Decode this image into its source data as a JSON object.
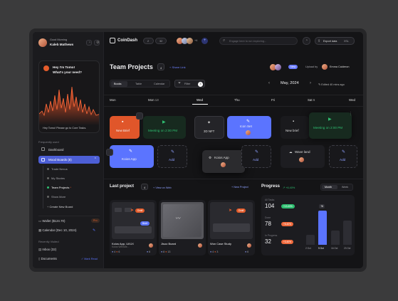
{
  "sidebar": {
    "greeting": "Good Morning",
    "user_name": "Kaleb Mathews",
    "ai_card": {
      "title_line1": "Hey I'm Tomo!",
      "title_line2": "What's your need?",
      "prompt": "Hey Tomo! Please go to Core Tasks."
    },
    "section_label": "Frequently used",
    "items": [
      {
        "label": "Dashboard"
      },
      {
        "label": "Mood Boards (8)"
      },
      {
        "label": "Trade Nexus"
      },
      {
        "label": "My Stories"
      },
      {
        "label": "Team Projects"
      },
      {
        "label": "Show More"
      },
      {
        "label": "Create New Board"
      }
    ],
    "wallet": {
      "label": "Wallet ($124.70)",
      "badge": "Pro"
    },
    "calendar": {
      "label": "Calendar (Dec 10, 2024)"
    },
    "recent_label": "Recently Visited",
    "inbox": {
      "label": "Inbox (32)"
    },
    "documents": {
      "label": "Documents",
      "action": "Mark Read"
    }
  },
  "topbar": {
    "logo": "CoinDash",
    "counter_1": "2",
    "counter_2": "32",
    "avatar_count": "+4",
    "search_placeholder": "Engage here to run exploring...",
    "export_label": "Export data",
    "export_format": "XSL"
  },
  "page": {
    "title": "Team Projects",
    "count": "4",
    "share_label": "Share Link",
    "new_badge": "New",
    "uploaded_by": "Upload by",
    "uploader": "Emma Calderon",
    "tabs": [
      "Books",
      "Table",
      "Calendar"
    ],
    "filter_label": "Filter",
    "filter_count": "3",
    "month": "May, 2024",
    "edited": "Edited 40 mins ago"
  },
  "calendar": {
    "days": [
      "Mon",
      "Mon",
      "Tue",
      "Wed",
      "Thu",
      "Fri",
      "Sat",
      "Wed"
    ],
    "day_numbers": [
      "",
      "13",
      "",
      "",
      "",
      "",
      "6",
      ""
    ],
    "events": [
      {
        "label": "New Brief"
      },
      {
        "label": "Meeting on 2:00 PM"
      },
      {
        "label": "3D NFT"
      },
      {
        "label": "Icon Set"
      },
      {
        "label": "New brief"
      },
      {
        "label": "Meeting on 2:00 PM"
      },
      {
        "label": "Koios App"
      },
      {
        "label": "Add"
      },
      {
        "label": "Koios App"
      },
      {
        "label": "Add"
      },
      {
        "label": "Wave land"
      },
      {
        "label": "Add"
      }
    ]
  },
  "last_project": {
    "title": "Last project",
    "count": "4",
    "view_all": "View on Web",
    "new_project": "+ New Project",
    "cards": [
      {
        "name": "Koios App, UI/UX",
        "tag": "Draft",
        "tag2": "Brief",
        "sub": "Koios Website...",
        "stat1": "4",
        "stat2": "6",
        "stat3": "6"
      },
      {
        "name": "Jisoo Board",
        "tag": "",
        "sub": "",
        "stat1": "8",
        "stat2": "13",
        "stat3": ""
      },
      {
        "name": "Won Case Study",
        "tag": "Draft",
        "sub": "",
        "stat1": "4",
        "stat2": "3",
        "stat3": "6"
      }
    ]
  },
  "progress": {
    "title": "Progress",
    "change": "+6.40%",
    "toggle": [
      "Month",
      "Week"
    ],
    "stats": [
      {
        "label": "All Tasks",
        "value": "104",
        "delta": "+13.40%",
        "color": "#2fbf71"
      },
      {
        "label": "Done",
        "value": "78",
        "delta": "+6.40%",
        "color": "#f06a3d"
      },
      {
        "label": "In Progress",
        "value": "32",
        "delta": "+3.40%",
        "color": "#f06a3d"
      }
    ],
    "chart_labels": [
      "2 Oct",
      "9 Oct",
      "16 Oct",
      "23 Oct"
    ],
    "highlight_value": "78"
  },
  "chart_data": {
    "type": "bar",
    "categories": [
      "2 Oct",
      "9 Oct",
      "16 Oct",
      "23 Oct"
    ],
    "values": [
      22,
      78,
      32,
      55
    ],
    "title": "Progress",
    "xlabel": "",
    "ylabel": "",
    "ylim": [
      0,
      100
    ]
  },
  "colors": {
    "accent_blue": "#5b74ff",
    "accent_orange": "#e45c2b",
    "green": "#2fbf71"
  }
}
